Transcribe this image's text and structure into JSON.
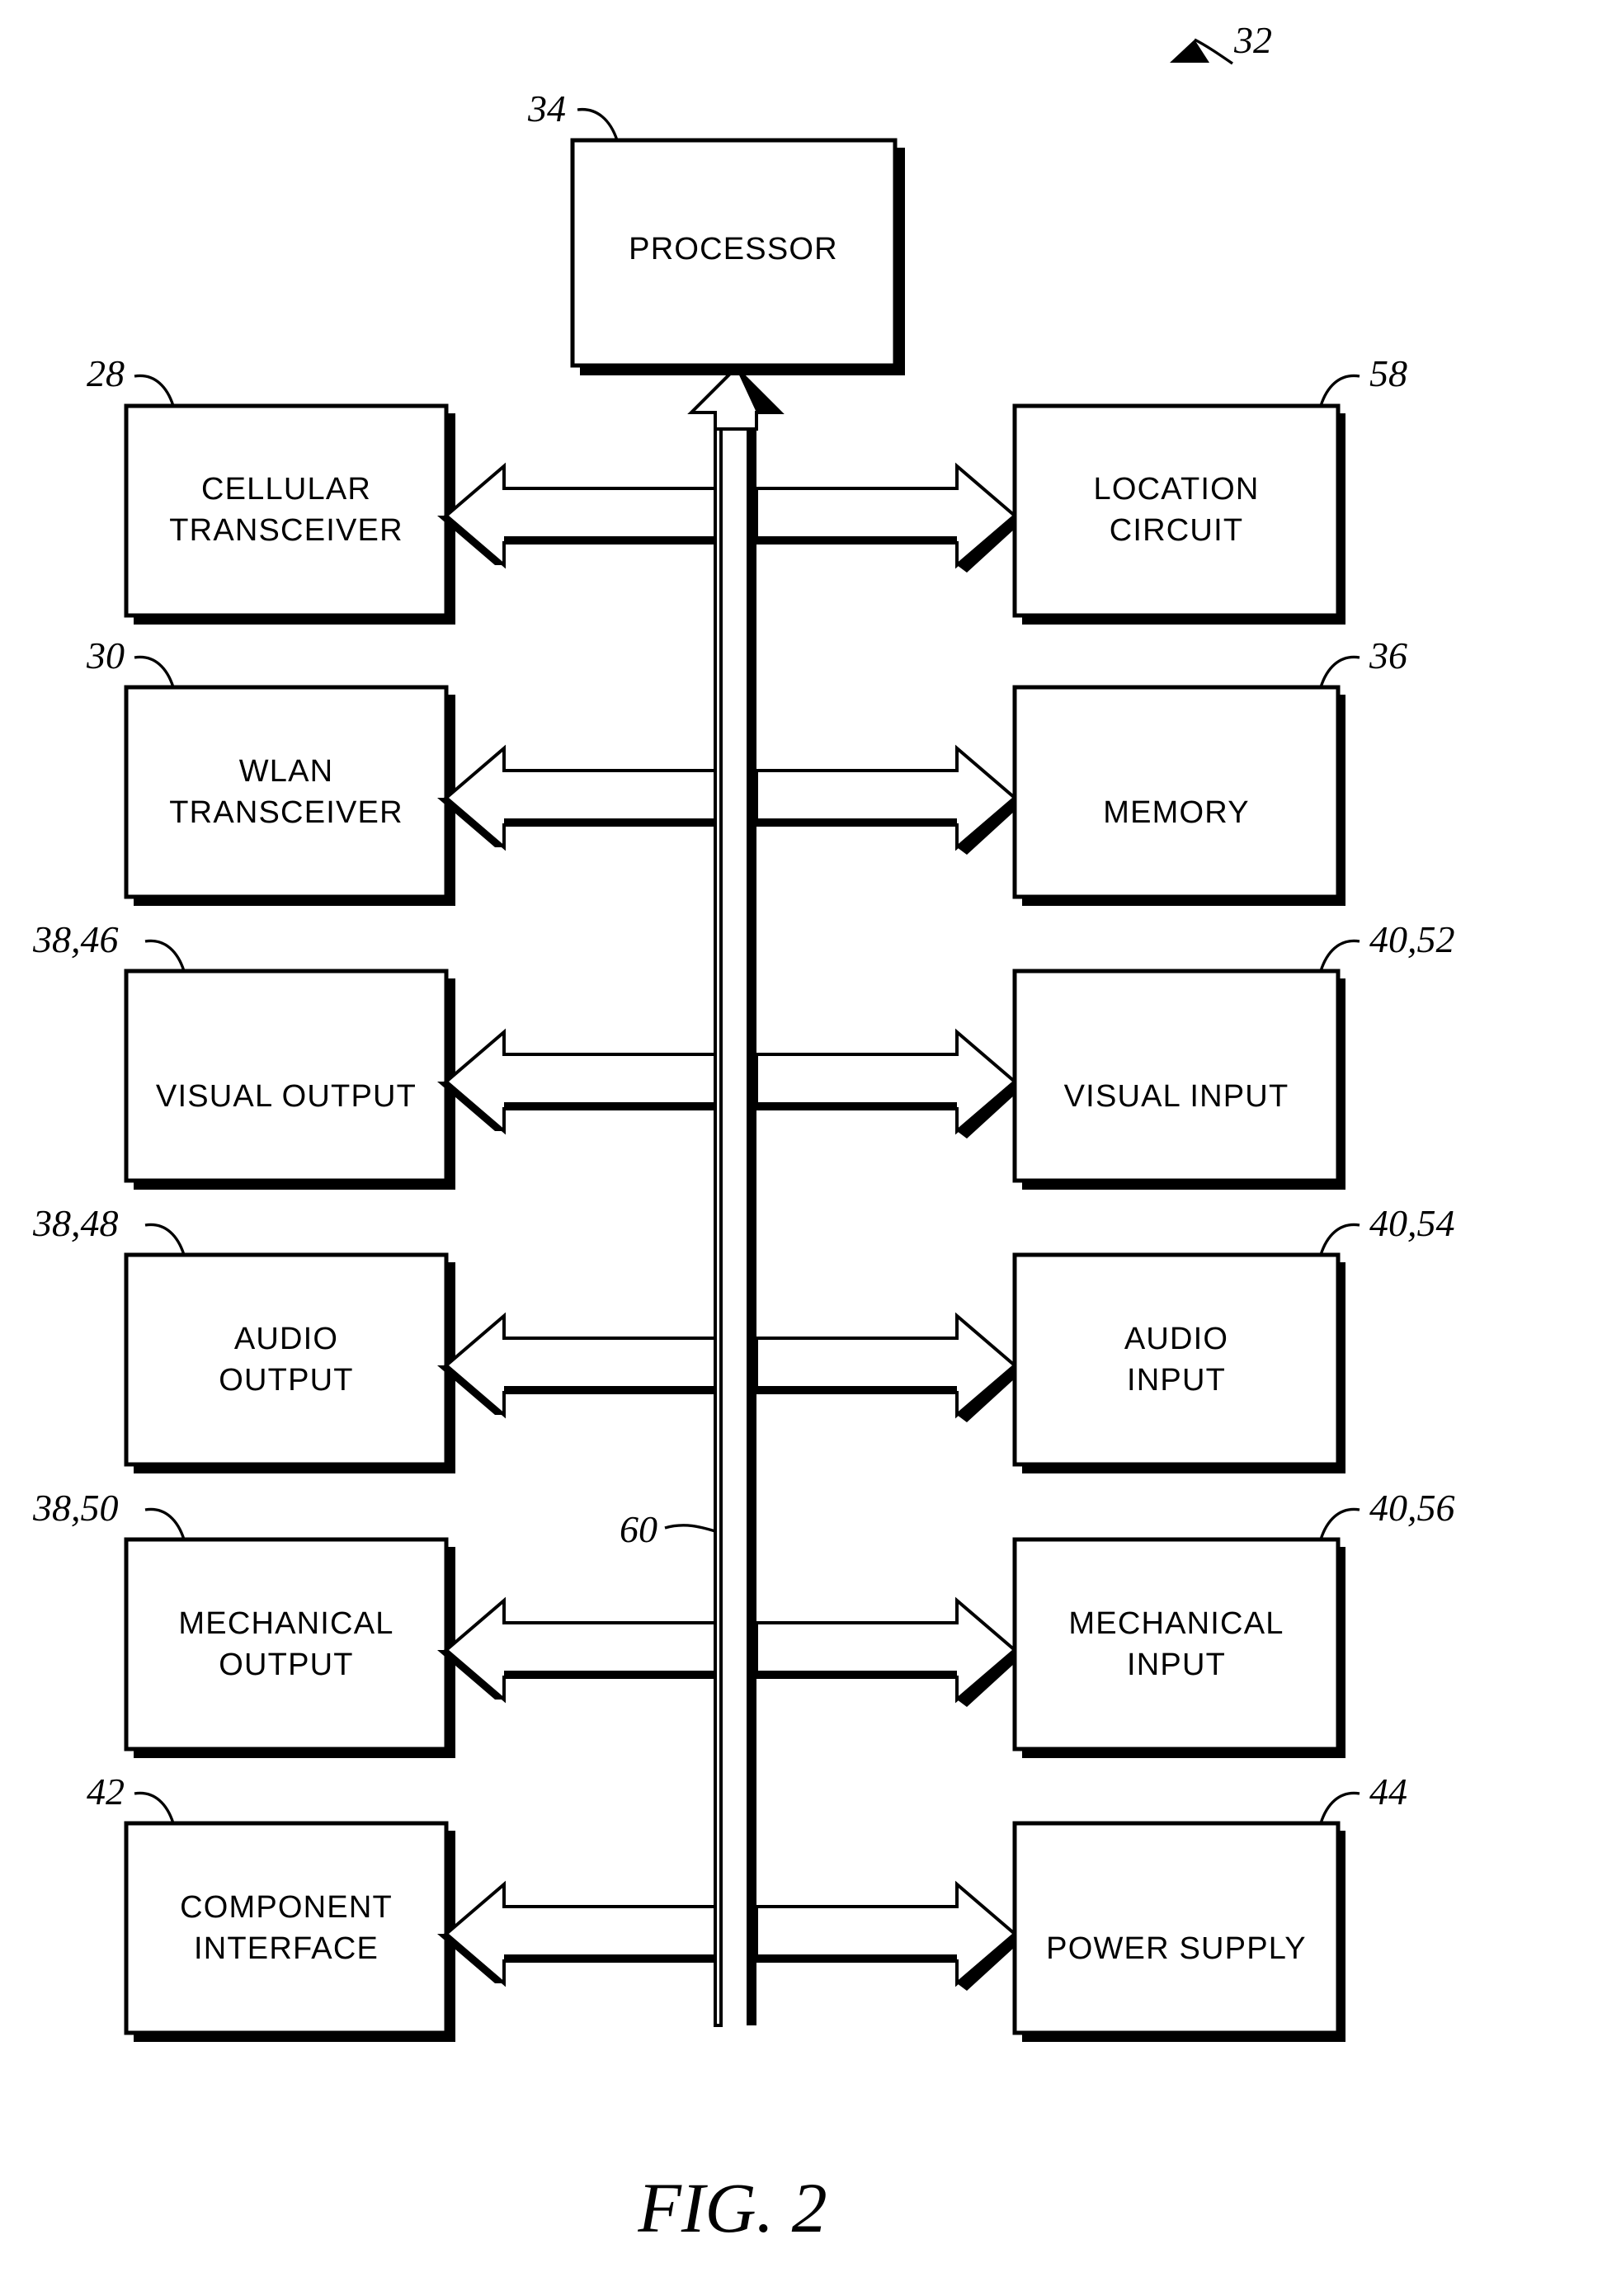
{
  "figure": {
    "caption": "FIG. 2",
    "system_ref": "32"
  },
  "processor": {
    "ref": "34",
    "label": "PROCESSOR"
  },
  "bus": {
    "ref": "60"
  },
  "rows": [
    {
      "left": {
        "ref": "28",
        "line1": "CELLULAR",
        "line2": "TRANSCEIVER"
      },
      "right": {
        "ref": "58",
        "line1": "LOCATION",
        "line2": "CIRCUIT"
      }
    },
    {
      "left": {
        "ref": "30",
        "line1": "WLAN",
        "line2": "TRANSCEIVER"
      },
      "right": {
        "ref": "36",
        "line1": "MEMORY",
        "line2": ""
      }
    },
    {
      "left": {
        "ref": "38,46",
        "line1": "VISUAL OUTPUT",
        "line2": ""
      },
      "right": {
        "ref": "40,52",
        "line1": "VISUAL INPUT",
        "line2": ""
      }
    },
    {
      "left": {
        "ref": "38,48",
        "line1": "AUDIO",
        "line2": "OUTPUT"
      },
      "right": {
        "ref": "40,54",
        "line1": "AUDIO",
        "line2": "INPUT"
      }
    },
    {
      "left": {
        "ref": "38,50",
        "line1": "MECHANICAL",
        "line2": "OUTPUT"
      },
      "right": {
        "ref": "40,56",
        "line1": "MECHANICAL",
        "line2": "INPUT"
      }
    },
    {
      "left": {
        "ref": "42",
        "line1": "COMPONENT",
        "line2": "INTERFACE"
      },
      "right": {
        "ref": "44",
        "line1": "POWER SUPPLY",
        "line2": ""
      }
    }
  ]
}
